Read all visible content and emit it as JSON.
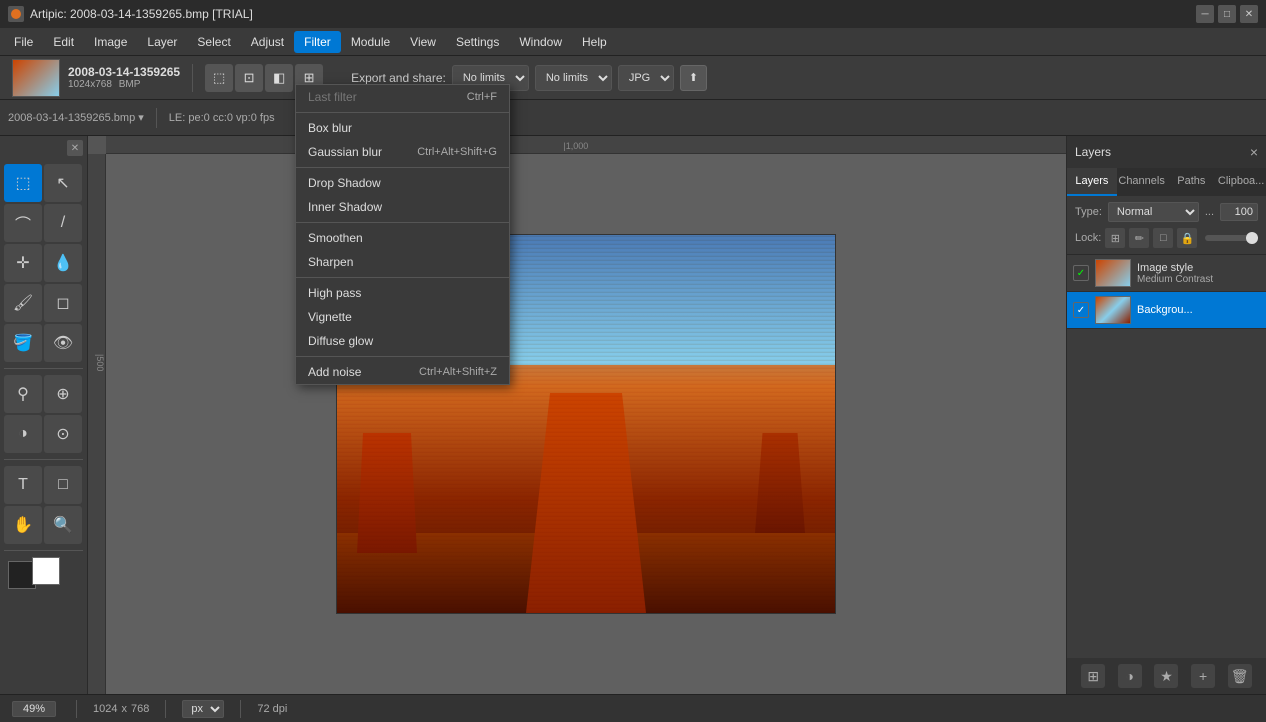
{
  "titlebar": {
    "title": "Artipic: 2008-03-14-1359265.bmp [TRIAL]",
    "controls": [
      "minimize",
      "maximize",
      "close"
    ]
  },
  "menubar": {
    "items": [
      {
        "id": "file",
        "label": "File"
      },
      {
        "id": "edit",
        "label": "Edit"
      },
      {
        "id": "image",
        "label": "Image"
      },
      {
        "id": "layer",
        "label": "Layer"
      },
      {
        "id": "select",
        "label": "Select"
      },
      {
        "id": "adjust",
        "label": "Adjust"
      },
      {
        "id": "filter",
        "label": "Filter",
        "active": true
      },
      {
        "id": "module",
        "label": "Module"
      },
      {
        "id": "view",
        "label": "View"
      },
      {
        "id": "settings",
        "label": "Settings"
      },
      {
        "id": "window",
        "label": "Window"
      },
      {
        "id": "help",
        "label": "Help"
      }
    ]
  },
  "toolbar": {
    "export_label": "Export and share:",
    "no_limits_1": "No limits",
    "no_limits_2": "No limits",
    "format": "JPG"
  },
  "toolbar2": {
    "filename": "2008-03-14-1359265.bmp",
    "info": "LE: pe:0 cc:0 vp:0 fps"
  },
  "filter_menu": {
    "items": [
      {
        "id": "last-filter",
        "label": "Last filter",
        "shortcut": "Ctrl+F",
        "disabled": true
      },
      {
        "sep": true
      },
      {
        "id": "box-blur",
        "label": "Box blur",
        "shortcut": ""
      },
      {
        "id": "gaussian-blur",
        "label": "Gaussian blur",
        "shortcut": "Ctrl+Alt+Shift+G"
      },
      {
        "sep": true
      },
      {
        "id": "drop-shadow",
        "label": "Drop Shadow",
        "shortcut": ""
      },
      {
        "id": "inner-shadow",
        "label": "Inner Shadow",
        "shortcut": ""
      },
      {
        "sep": true
      },
      {
        "id": "smoothen",
        "label": "Smoothen",
        "shortcut": ""
      },
      {
        "id": "sharpen",
        "label": "Sharpen",
        "shortcut": ""
      },
      {
        "sep": true
      },
      {
        "id": "high-pass",
        "label": "High pass",
        "shortcut": ""
      },
      {
        "id": "vignette",
        "label": "Vignette",
        "shortcut": ""
      },
      {
        "id": "diffuse-glow",
        "label": "Diffuse glow",
        "shortcut": ""
      },
      {
        "sep": true
      },
      {
        "id": "add-noise",
        "label": "Add noise",
        "shortcut": "Ctrl+Alt+Shift+Z"
      }
    ]
  },
  "layers_panel": {
    "title": "Layers",
    "tabs": [
      "Layers",
      "Channels",
      "Paths",
      "Clipboa..."
    ],
    "type_label": "Type:",
    "type_value": "Normal",
    "opacity_value": "100",
    "lock_label": "Lock:",
    "layers": [
      {
        "id": "image-style",
        "name": "Image style",
        "sublabel": "Medium Contrast",
        "checked": true,
        "active": false
      },
      {
        "id": "background",
        "name": "Backgrou...",
        "sublabel": "",
        "checked": true,
        "active": true
      }
    ],
    "close_btn": "×"
  },
  "statusbar": {
    "zoom": "49%",
    "dimensions": "1024 x 768",
    "unit": "px",
    "dpi": "72 dpi"
  },
  "file_info": {
    "name": "2008-03-14-1359265",
    "dimensions": "1024x768",
    "format": "BMP"
  }
}
